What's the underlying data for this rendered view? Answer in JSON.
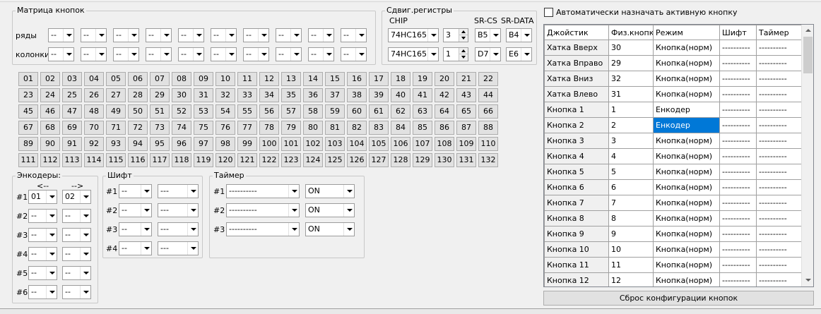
{
  "matrix": {
    "legend": "Матрица кнопок",
    "rows_label": "ряды",
    "cols_label": "колонки",
    "rows": [
      "--",
      "--",
      "--",
      "--",
      "--",
      "--",
      "--",
      "--",
      "--",
      "--"
    ],
    "cols": [
      "--",
      "--",
      "--",
      "--",
      "--",
      "--",
      "--",
      "--",
      "--",
      "--"
    ]
  },
  "shift_regs": {
    "legend": "Сдвиг.регистры",
    "col_chip": "CHIP",
    "col_cs": "SR-CS",
    "col_data": "SR-DATA",
    "rows": [
      {
        "chip": "74HC165",
        "count": "3",
        "cs": "B5",
        "data": "B4"
      },
      {
        "chip": "74HC165",
        "count": "1",
        "cs": "D7",
        "data": "E6"
      }
    ]
  },
  "auto_assign": {
    "label": "Автоматически назначать активную кнопку",
    "checked": false
  },
  "buttons": [
    "01",
    "02",
    "03",
    "04",
    "05",
    "06",
    "07",
    "08",
    "09",
    "10",
    "11",
    "12",
    "13",
    "14",
    "15",
    "16",
    "17",
    "18",
    "19",
    "20",
    "21",
    "22",
    "23",
    "24",
    "25",
    "26",
    "27",
    "28",
    "29",
    "30",
    "31",
    "32",
    "33",
    "34",
    "35",
    "36",
    "37",
    "38",
    "39",
    "40",
    "41",
    "42",
    "43",
    "44",
    "45",
    "46",
    "47",
    "48",
    "49",
    "50",
    "51",
    "52",
    "53",
    "54",
    "55",
    "56",
    "57",
    "58",
    "59",
    "60",
    "61",
    "62",
    "63",
    "64",
    "65",
    "66",
    "67",
    "68",
    "69",
    "70",
    "71",
    "72",
    "73",
    "74",
    "75",
    "76",
    "77",
    "78",
    "79",
    "80",
    "81",
    "82",
    "83",
    "84",
    "85",
    "86",
    "87",
    "88",
    "89",
    "90",
    "91",
    "92",
    "93",
    "94",
    "95",
    "96",
    "97",
    "98",
    "99",
    "100",
    "101",
    "102",
    "103",
    "104",
    "105",
    "106",
    "107",
    "108",
    "109",
    "110",
    "111",
    "112",
    "113",
    "114",
    "115",
    "116",
    "117",
    "118",
    "119",
    "120",
    "121",
    "122",
    "123",
    "124",
    "125",
    "126",
    "127",
    "128",
    "129",
    "130",
    "131",
    "132"
  ],
  "encoders": {
    "legend": "Энкодеры:",
    "dir_left": "<--",
    "dir_right": "-->",
    "rows": [
      {
        "label": "#1",
        "a": "01",
        "b": "02"
      },
      {
        "label": "#2",
        "a": "--",
        "b": "--"
      },
      {
        "label": "#3",
        "a": "--",
        "b": "--"
      },
      {
        "label": "#4",
        "a": "--",
        "b": "--"
      },
      {
        "label": "#5",
        "a": "--",
        "b": "--"
      },
      {
        "label": "#6",
        "a": "--",
        "b": "--"
      }
    ]
  },
  "shift": {
    "legend": "Шифт",
    "rows": [
      {
        "label": "#1",
        "a": "--",
        "b": "---"
      },
      {
        "label": "#2",
        "a": "--",
        "b": "---"
      },
      {
        "label": "#3",
        "a": "--",
        "b": "---"
      },
      {
        "label": "#4",
        "a": "--",
        "b": "---"
      }
    ]
  },
  "timer": {
    "legend": "Таймер",
    "rows": [
      {
        "label": "#1",
        "a": "----------",
        "b": "ON"
      },
      {
        "label": "#2",
        "a": "----------",
        "b": "ON"
      },
      {
        "label": "#3",
        "a": "----------",
        "b": "ON"
      }
    ]
  },
  "table": {
    "headers": [
      "Джойстик",
      "Физ.кнопка",
      "Режим",
      "Шифт",
      "Таймер"
    ],
    "rows": [
      {
        "name": "Хатка Вверх",
        "phys": "30",
        "mode": "Кнопка(норм)",
        "shift": "----------",
        "timer": "----------"
      },
      {
        "name": "Хатка Вправо",
        "phys": "29",
        "mode": "Кнопка(норм)",
        "shift": "----------",
        "timer": "----------"
      },
      {
        "name": "Хатка Вниз",
        "phys": "32",
        "mode": "Кнопка(норм)",
        "shift": "----------",
        "timer": "----------"
      },
      {
        "name": "Хатка Влево",
        "phys": "31",
        "mode": "Кнопка(норм)",
        "shift": "----------",
        "timer": "----------"
      },
      {
        "name": "Кнопка 1",
        "phys": "1",
        "mode": "Енкодер",
        "shift": "----------",
        "timer": "----------"
      },
      {
        "name": "Кнопка 2",
        "phys": "2",
        "mode": "Енкодер",
        "shift": "----------",
        "timer": "----------",
        "selected": true
      },
      {
        "name": "Кнопка 3",
        "phys": "3",
        "mode": "Кнопка(норм)",
        "shift": "----------",
        "timer": "----------"
      },
      {
        "name": "Кнопка 4",
        "phys": "4",
        "mode": "Кнопка(норм)",
        "shift": "----------",
        "timer": "----------"
      },
      {
        "name": "Кнопка 5",
        "phys": "5",
        "mode": "Кнопка(норм)",
        "shift": "----------",
        "timer": "----------"
      },
      {
        "name": "Кнопка 6",
        "phys": "6",
        "mode": "Кнопка(норм)",
        "shift": "----------",
        "timer": "----------"
      },
      {
        "name": "Кнопка 7",
        "phys": "7",
        "mode": "Кнопка(норм)",
        "shift": "----------",
        "timer": "----------"
      },
      {
        "name": "Кнопка 8",
        "phys": "8",
        "mode": "Кнопка(норм)",
        "shift": "----------",
        "timer": "----------"
      },
      {
        "name": "Кнопка 9",
        "phys": "9",
        "mode": "Кнопка(норм)",
        "shift": "----------",
        "timer": "----------"
      },
      {
        "name": "Кнопка 10",
        "phys": "10",
        "mode": "Кнопка(норм)",
        "shift": "----------",
        "timer": "----------"
      },
      {
        "name": "Кнопка 11",
        "phys": "11",
        "mode": "Кнопка(норм)",
        "shift": "----------",
        "timer": "----------"
      },
      {
        "name": "Кнопка 12",
        "phys": "12",
        "mode": "Кнопка(норм)",
        "shift": "----------",
        "timer": "----------"
      }
    ]
  },
  "reset_label": "Сброс конфигурации кнопок"
}
